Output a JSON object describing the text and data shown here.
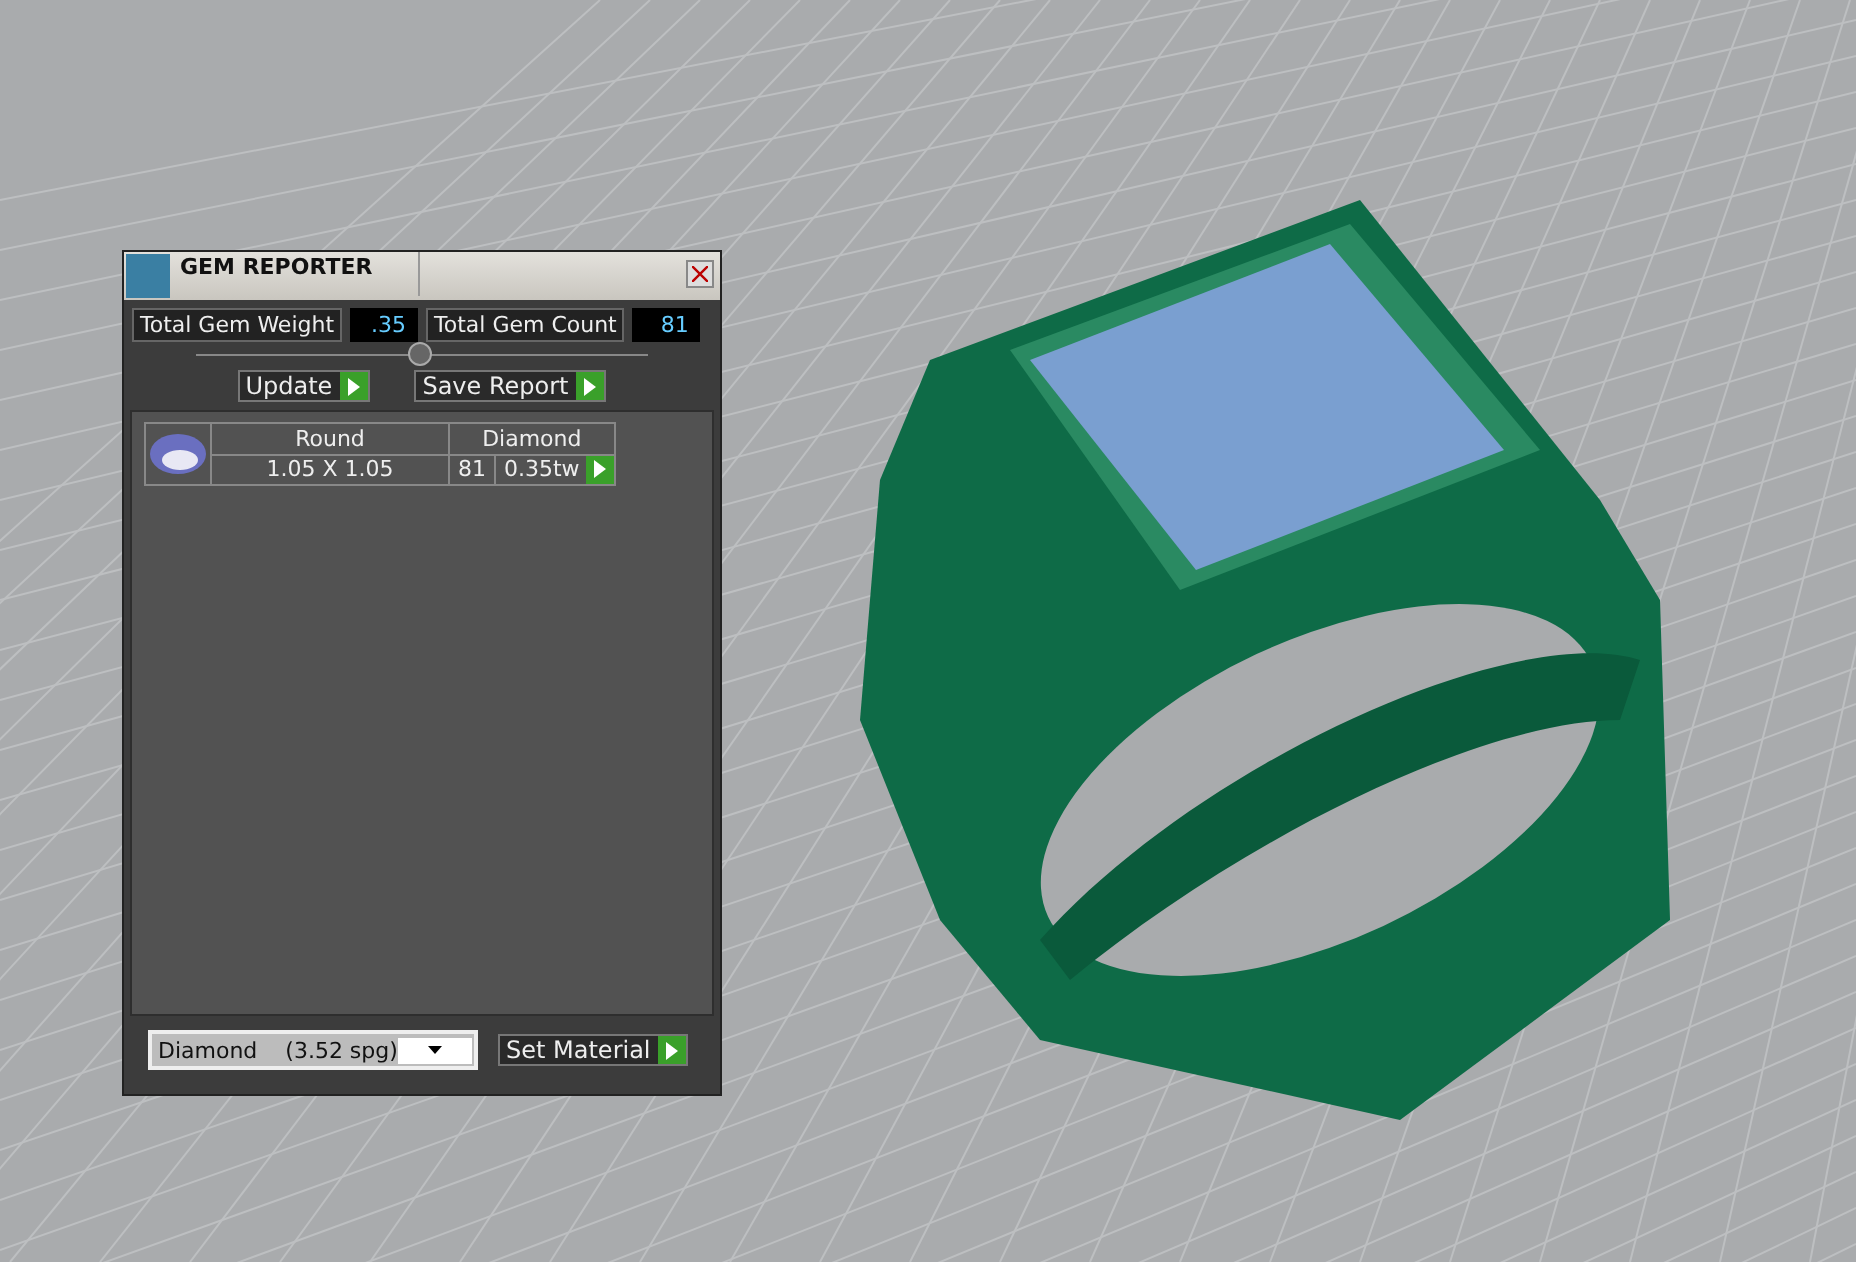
{
  "panel": {
    "title": "GEM REPORTER",
    "total_weight": {
      "label": "Total Gem Weight",
      "value": ".35"
    },
    "total_count": {
      "label": "Total Gem Count",
      "value": "81"
    },
    "buttons": [
      "Update",
      "Save Report"
    ],
    "gems": [
      {
        "shape": "Round",
        "material": "Diamond",
        "size": "1.05 X 1.05",
        "count": "81",
        "weight": "0.35tw"
      }
    ],
    "material_select": {
      "value": "Diamond    (3.52 spg)"
    },
    "set_button": "Set Material"
  }
}
